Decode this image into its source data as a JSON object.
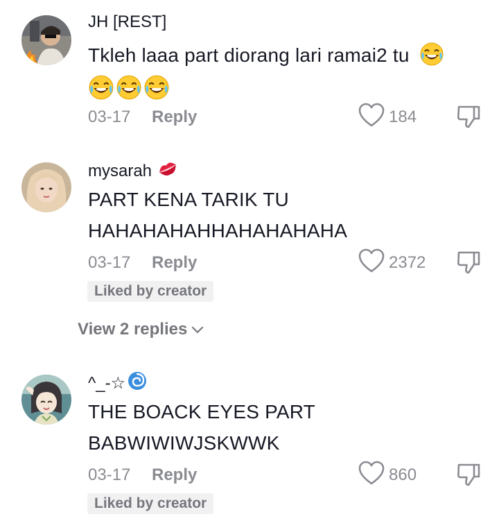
{
  "comments": [
    {
      "username": "JH [REST]",
      "text_lines": [
        "Tkleh laaa part diorang lari ramai2 tu"
      ],
      "date": "03-17",
      "reply_label": "Reply",
      "likes": "184"
    },
    {
      "username": "mysarah",
      "text_lines": [
        "PART KENA TARIK TU",
        "HAHAHAHAHHAHAHAHAHA"
      ],
      "date": "03-17",
      "reply_label": "Reply",
      "likes": "2372",
      "badge": "Liked by creator"
    },
    {
      "username": "^_-☆",
      "text_lines": [
        "THE BOACK EYES PART",
        "BABWIWIWJSKWWK"
      ],
      "date": "03-17",
      "reply_label": "Reply",
      "likes": "860",
      "badge": "Liked by creator"
    }
  ],
  "view_replies_label": "View 2 replies",
  "colors": {
    "text_primary": "#161823",
    "text_secondary": "#8a8b91",
    "badge_bg": "#f1f1f2"
  },
  "icons": [
    "heart-outline-icon",
    "thumbs-down-icon",
    "chevron-down-icon",
    "laughing-emoji",
    "kiss-mark-emoji",
    "cyclone-emoji"
  ]
}
